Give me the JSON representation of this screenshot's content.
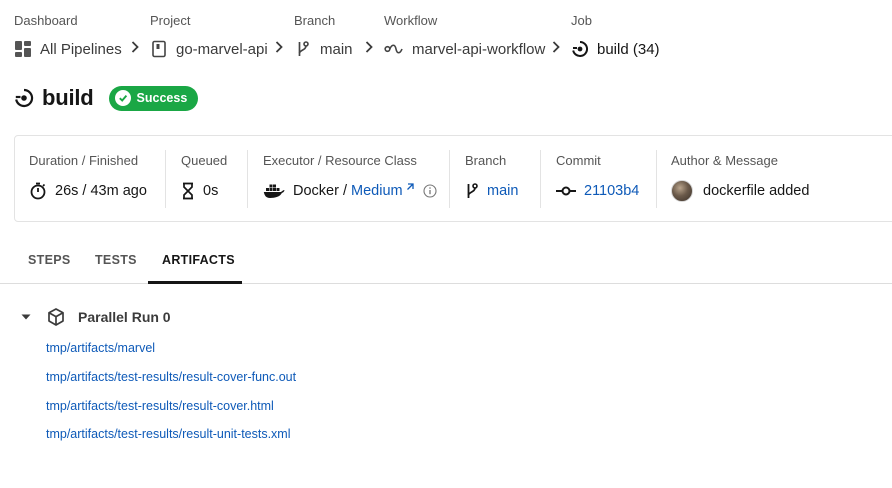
{
  "breadcrumb": {
    "dashboard": {
      "label": "Dashboard",
      "value": "All Pipelines",
      "icon": "grid-icon"
    },
    "project": {
      "label": "Project",
      "value": "go-marvel-api",
      "icon": "repo-icon"
    },
    "branch": {
      "label": "Branch",
      "value": "main",
      "icon": "branch-icon"
    },
    "workflow": {
      "label": "Workflow",
      "value": "marvel-api-workflow",
      "icon": "workflow-icon"
    },
    "job": {
      "label": "Job",
      "value": "build (34)",
      "icon": "job-icon"
    }
  },
  "header": {
    "title": "build",
    "status": "Success",
    "status_color": "#1aa745"
  },
  "info": {
    "duration": {
      "label": "Duration / Finished",
      "value": "26s / 43m ago"
    },
    "queued": {
      "label": "Queued",
      "value": "0s"
    },
    "executor": {
      "label": "Executor / Resource Class",
      "executor": "Docker",
      "separator": " / ",
      "resource_class": "Medium"
    },
    "branch": {
      "label": "Branch",
      "value": "main"
    },
    "commit": {
      "label": "Commit",
      "value": "21103b4"
    },
    "author": {
      "label": "Author & Message",
      "message": "dockerfile added"
    }
  },
  "tabs": [
    {
      "label": "STEPS",
      "active": false
    },
    {
      "label": "TESTS",
      "active": false
    },
    {
      "label": "ARTIFACTS",
      "active": true
    }
  ],
  "artifacts": {
    "group_title": "Parallel Run 0",
    "files": [
      "tmp/artifacts/marvel",
      "tmp/artifacts/test-results/result-cover-func.out",
      "tmp/artifacts/test-results/result-cover.html",
      "tmp/artifacts/test-results/result-unit-tests.xml"
    ]
  },
  "colors": {
    "link": "#0e5ab8",
    "success": "#1aa745",
    "text": "#161616",
    "muted": "#555555"
  }
}
